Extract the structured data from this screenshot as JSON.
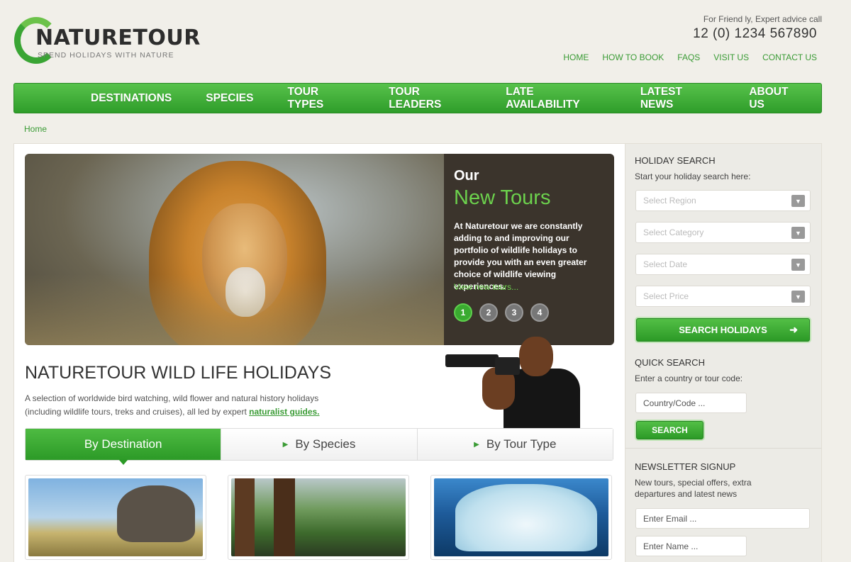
{
  "header": {
    "logo_name": "NATURETOUR",
    "logo_tagline": "SPEND HOLIDAYS WITH NATURE",
    "advice_text": "For Friend   ly, Expert advice call",
    "phone": "12 (0) 1234 567890",
    "top_links": [
      "HOME",
      "HOW TO BOOK",
      "FAQS",
      "VISIT US",
      "CONTACT US"
    ]
  },
  "main_nav": [
    "DESTINATIONS",
    "SPECIES",
    "TOUR TYPES",
    "TOUR LEADERS",
    "LATE AVAILABILITY",
    "LATEST NEWS",
    "ABOUT US"
  ],
  "breadcrumb": "Home",
  "slider": {
    "heading_small": "Our",
    "heading_large": "New Tours",
    "text": "At Naturetour we are constantly adding to and improving our portfolio of wildlife holidays to provide you with an even greater choice of wildlife viewing experiences.",
    "link": "View new tours...",
    "dots": [
      "1",
      "2",
      "3",
      "4"
    ],
    "active_dot": 1
  },
  "holidays": {
    "title": "NATURETOUR WILD LIFE HOLIDAYS",
    "desc": "A selection of worldwide bird watching, wild flower and natural history holidays (including wildlife tours, treks and cruises), all led by expert",
    "link": "naturalist guides."
  },
  "tabs": [
    "By Destination",
    "By Species",
    "By Tour Type"
  ],
  "sidebar": {
    "holiday_search": {
      "heading": "HOLIDAY SEARCH",
      "intro": "Start your holiday search here:",
      "selects": [
        "Select Region",
        "Select Category",
        "Select Date",
        "Select Price"
      ],
      "button": "SEARCH HOLIDAYS"
    },
    "quick_search": {
      "heading": "QUICK SEARCH",
      "intro": "Enter a country or tour code:",
      "placeholder": "Country/Code ...",
      "button": "SEARCH"
    },
    "newsletter": {
      "heading": "NEWSLETTER SIGNUP",
      "intro": "New tours, special offers, extra departures and latest news",
      "email_placeholder": "Enter Email ...",
      "name_placeholder": "Enter Name ..."
    }
  },
  "colors": {
    "brand_green": "#3aa534",
    "accent_light_green": "#6cd14d",
    "slide_panel": "#3b342c"
  }
}
